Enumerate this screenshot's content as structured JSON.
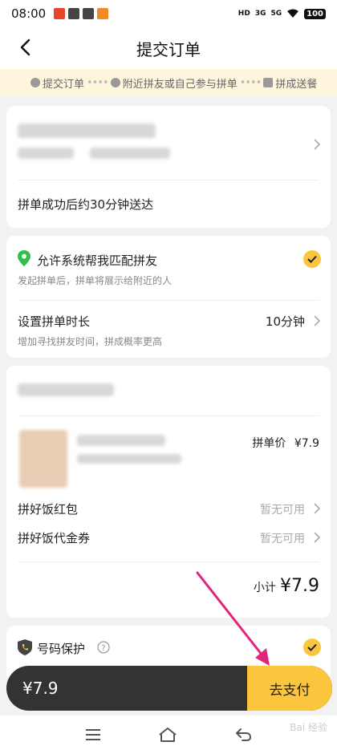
{
  "status_bar": {
    "time": "08:00",
    "network_labels": [
      "HD",
      "3G",
      "5G"
    ],
    "battery": "100"
  },
  "nav": {
    "title": "提交订单"
  },
  "steps": [
    {
      "label": "提交订单"
    },
    {
      "label": "附近拼友或自己参与拼单"
    },
    {
      "label": "拼成送餐"
    }
  ],
  "delivery": {
    "eta_text": "拼单成功后约30分钟送达"
  },
  "matching": {
    "title": "允许系统帮我匹配拼友",
    "subtitle": "发起拼单后，拼单将展示给附近的人",
    "duration_label": "设置拼单时长",
    "duration_value": "10分钟",
    "duration_subtitle": "增加寻找拼友时间，拼成概率更高"
  },
  "order": {
    "price_label": "拼单价",
    "price_value": "¥7.9",
    "red_packet_label": "拼好饭红包",
    "red_packet_value": "暂无可用",
    "voucher_label": "拼好饭代金券",
    "voucher_value": "暂无可用",
    "subtotal_label": "小计",
    "subtotal_value": "¥7.9"
  },
  "privacy": {
    "title": "号码保护"
  },
  "pay_bar": {
    "amount": "¥7.9",
    "button": "去支付"
  },
  "watermark": "Bai 经验",
  "colors": {
    "accent": "#fbc53d",
    "pay_bar_bg": "#333333",
    "steps_bg": "#fdf5dc",
    "annotation_arrow": "#e0267c",
    "location_pin": "#2fbf4a"
  }
}
